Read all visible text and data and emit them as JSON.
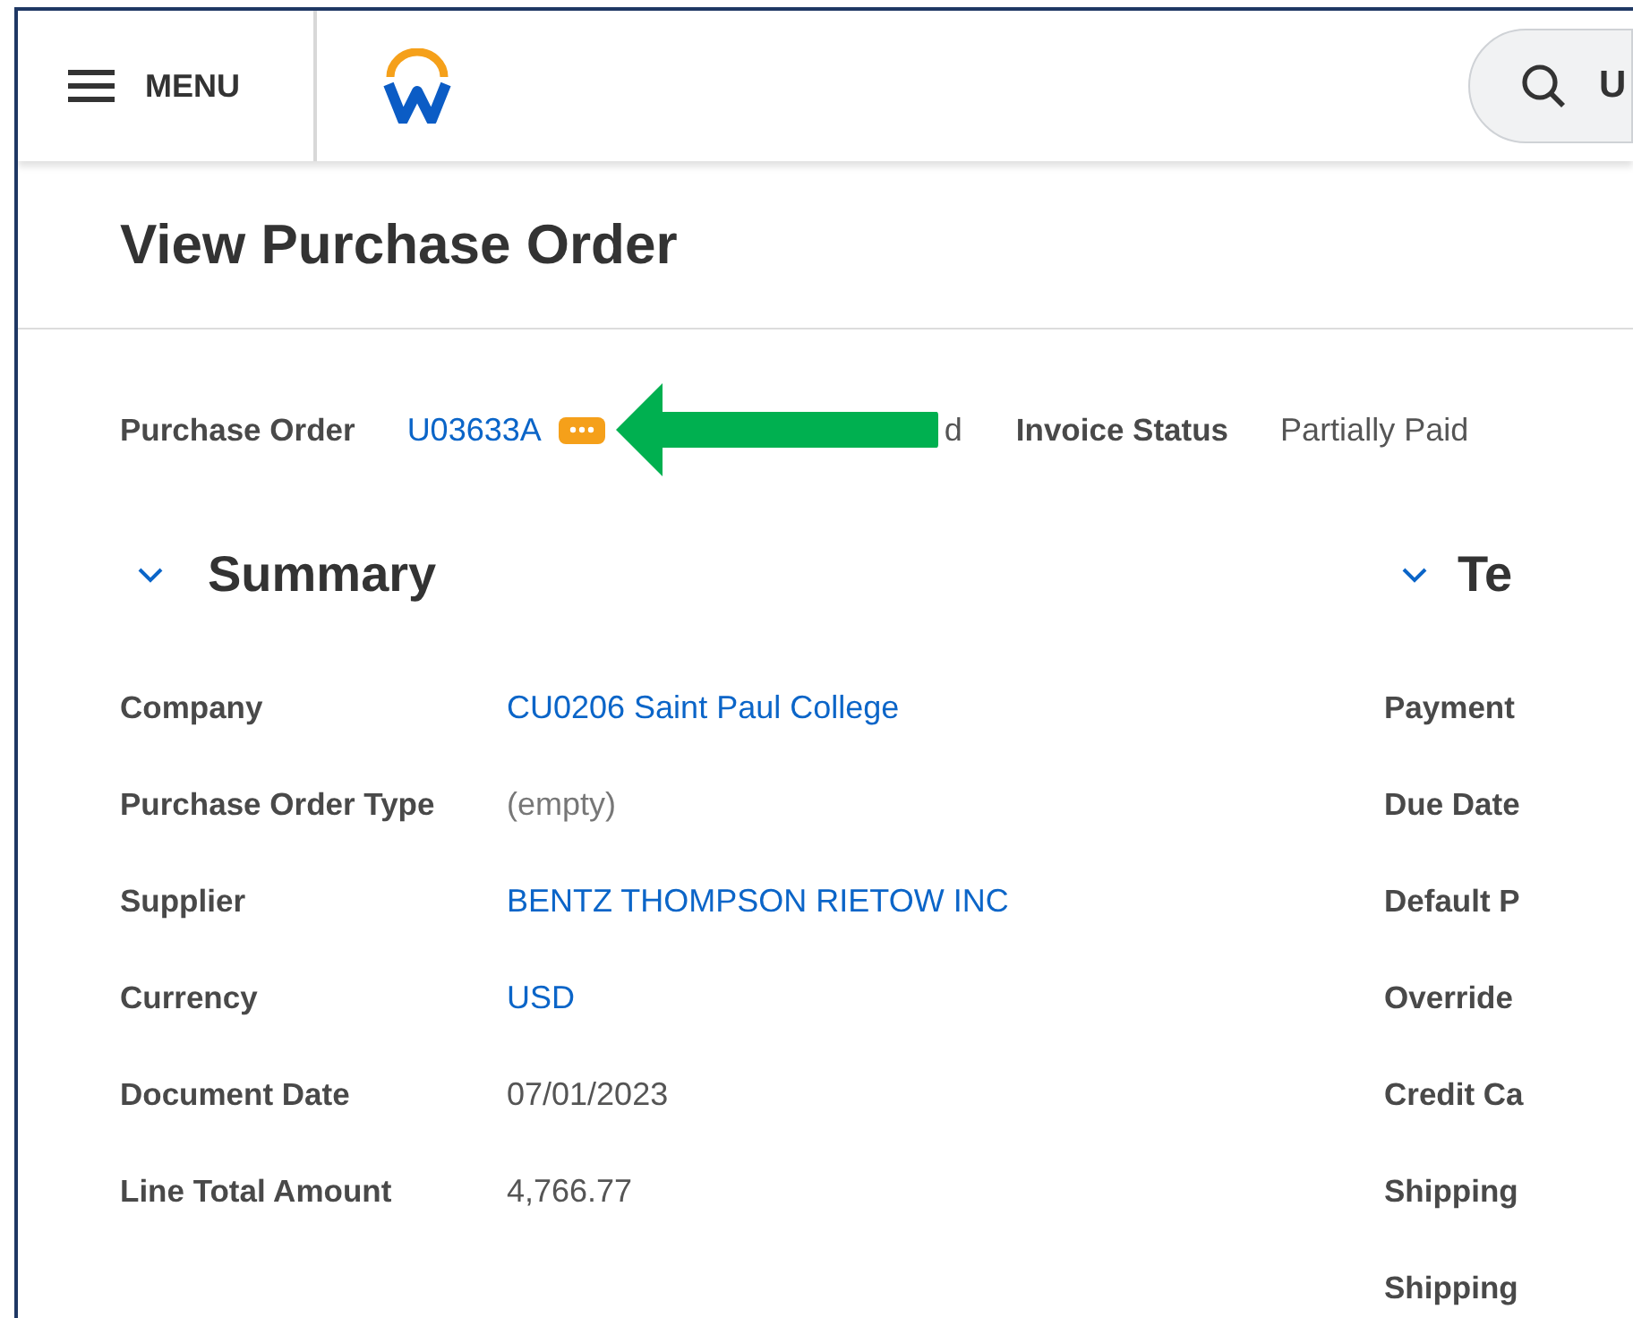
{
  "header": {
    "menu_label": "MENU",
    "search_value": "U"
  },
  "title": "View Purchase Order",
  "top_fields": [
    {
      "label": "Purchase Order",
      "value": "U03633A",
      "kind": "link",
      "has_actions": true,
      "hidden_tail": "d"
    },
    {
      "label": "Invoice Status",
      "value": "Partially Paid",
      "kind": "plain",
      "has_actions": false
    }
  ],
  "summary": {
    "title": "Summary",
    "expanded": true,
    "fields": [
      {
        "label": "Company",
        "value": "CU0206 Saint Paul College",
        "kind": "link"
      },
      {
        "label": "Purchase Order Type",
        "value": "(empty)",
        "kind": "empty"
      },
      {
        "label": "Supplier",
        "value": "BENTZ THOMPSON RIETOW INC",
        "kind": "link"
      },
      {
        "label": "Currency",
        "value": "USD",
        "kind": "link"
      },
      {
        "label": "Document Date",
        "value": "07/01/2023",
        "kind": "plain"
      },
      {
        "label": "Line Total Amount",
        "value": "4,766.77",
        "kind": "plain"
      }
    ]
  },
  "terms": {
    "title": "Te",
    "expanded": true,
    "fields": [
      {
        "label": "Payment"
      },
      {
        "label": "Due Date"
      },
      {
        "label": "Default P"
      },
      {
        "label": "Override"
      },
      {
        "label": "Credit Ca"
      },
      {
        "label": "Shipping"
      },
      {
        "label": "Shipping"
      }
    ]
  }
}
